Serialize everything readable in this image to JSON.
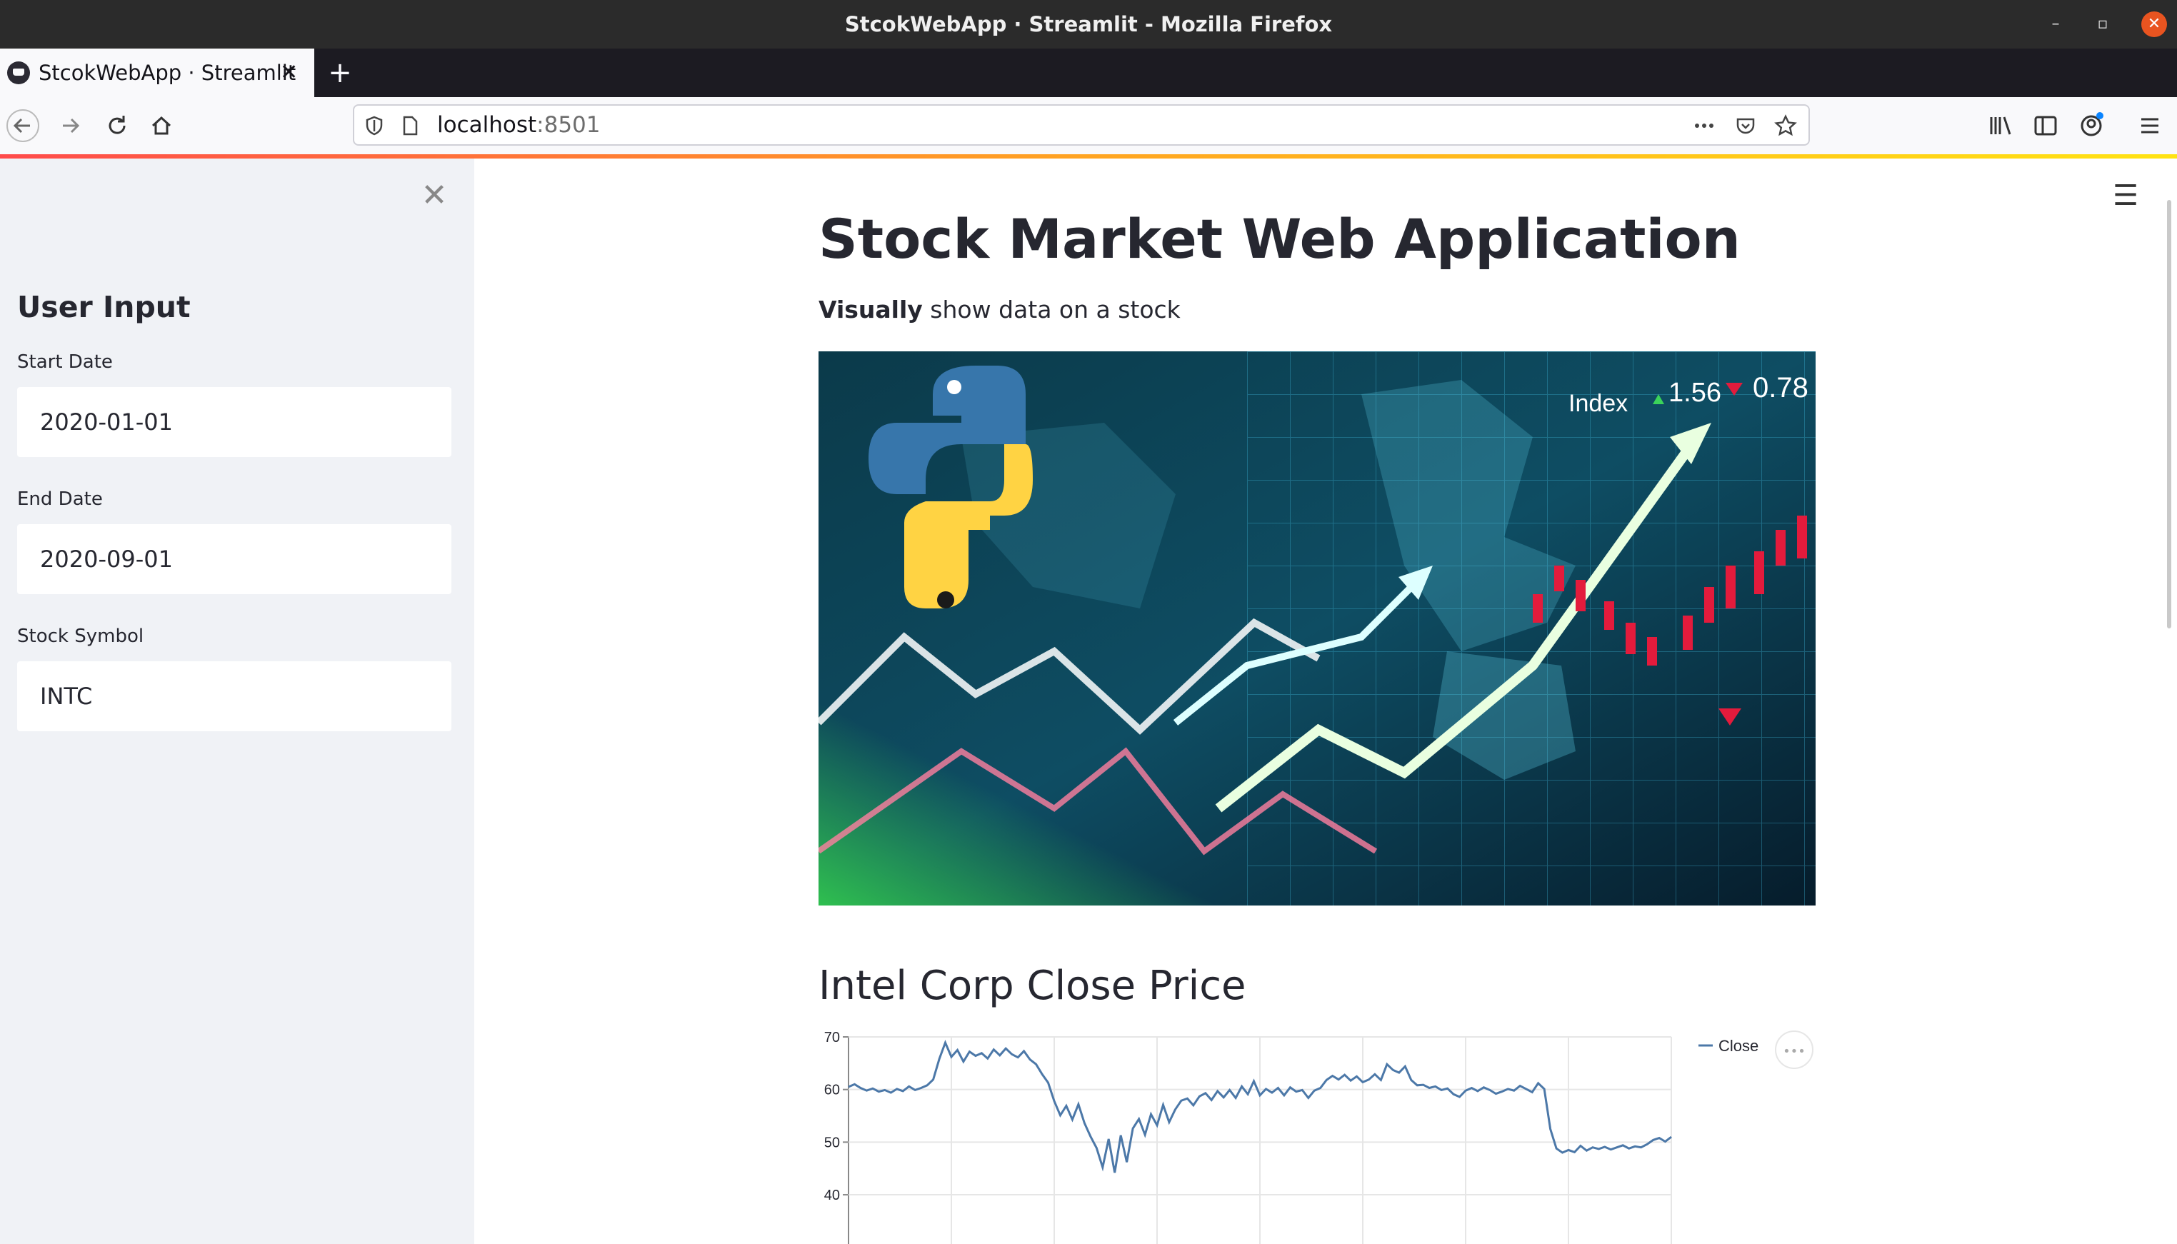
{
  "window": {
    "title": "StcokWebApp · Streamlit - Mozilla Firefox",
    "minimize_glyph": "–",
    "maximize_glyph": "▫",
    "close_glyph": "✕"
  },
  "tabs": [
    {
      "label": "StcokWebApp · Streamlit",
      "close_glyph": "✕",
      "active": true
    }
  ],
  "newtab_glyph": "+",
  "navbar": {
    "url_host": "localhost",
    "url_port": ":8501",
    "icons": [
      "back-icon",
      "forward-icon",
      "reload-icon",
      "home-icon",
      "shield-icon",
      "page-icon",
      "more-icon",
      "pocket-icon",
      "star-icon",
      "library-icon",
      "sidebar-icon",
      "account-icon",
      "menu-icon"
    ]
  },
  "sidebar": {
    "close_glyph": "✕",
    "heading": "User Input",
    "fields": [
      {
        "label": "Start Date",
        "value": "2020-01-01"
      },
      {
        "label": "End Date",
        "value": "2020-09-01"
      },
      {
        "label": "Stock Symbol",
        "value": "INTC"
      }
    ]
  },
  "main": {
    "title": "Stock Market Web Application",
    "subtitle_bold": "Visually",
    "subtitle_rest": " show data on a stock",
    "hero_text": {
      "index": "Index",
      "up": "1.56",
      "down": "0.78"
    },
    "chart_title": "Intel Corp Close Price",
    "menu_glyph": "☰",
    "chart_menu_glyph": "•••"
  },
  "colors": {
    "accent": "#ff4b4b",
    "sidebar_bg": "#f0f2f6",
    "text": "#262730",
    "line": "#4c78a8"
  },
  "chart_data": {
    "type": "line",
    "series": [
      {
        "name": "Close",
        "values": [
          60.5,
          61.0,
          60.3,
          59.8,
          60.2,
          59.6,
          59.9,
          59.4,
          60.1,
          59.7,
          60.6,
          59.9,
          60.3,
          60.8,
          61.9,
          65.8,
          68.9,
          66.2,
          67.5,
          65.3,
          67.2,
          66.4,
          66.9,
          65.9,
          67.6,
          66.5,
          67.8,
          66.7,
          66.1,
          67.3,
          65.7,
          64.8,
          62.9,
          61.3,
          57.8,
          55.1,
          56.9,
          54.3,
          57.2,
          53.6,
          51.1,
          48.9,
          45.2,
          50.6,
          44.2,
          51.3,
          46.2,
          52.6,
          54.4,
          51.4,
          55.3,
          53.2,
          57.1,
          53.8,
          56.2,
          57.9,
          58.3,
          57.0,
          58.7,
          59.3,
          58.0,
          59.7,
          58.5,
          59.9,
          58.4,
          60.6,
          59.1,
          61.6,
          58.9,
          60.1,
          59.4,
          60.3,
          58.9,
          60.4,
          59.6,
          59.9,
          58.4,
          59.8,
          60.3,
          61.8,
          62.6,
          61.9,
          62.8,
          61.7,
          62.5,
          61.4,
          61.9,
          62.9,
          61.8,
          64.8,
          63.7,
          63.2,
          64.4,
          61.8,
          60.8,
          60.9,
          60.3,
          60.6,
          59.9,
          60.2,
          59.1,
          58.6,
          59.8,
          60.3,
          59.7,
          60.4,
          59.9,
          59.2,
          59.6,
          60.1,
          59.8,
          60.7,
          60.1,
          59.5,
          61.2,
          60.1,
          52.5,
          48.8,
          48.0,
          48.5,
          48.1,
          49.3,
          48.4,
          49.0,
          48.7,
          49.1,
          48.6,
          49.0,
          49.4,
          48.8,
          49.2,
          49.0,
          49.6,
          50.4,
          50.8,
          50.1,
          51.0
        ]
      }
    ],
    "x_ticks": [
      "",
      "",
      "",
      "",
      "",
      "",
      "",
      ""
    ],
    "y_ticks": [
      40,
      50,
      60,
      70
    ],
    "ylim": [
      40,
      70
    ],
    "legend": "top-right",
    "grid": true
  }
}
